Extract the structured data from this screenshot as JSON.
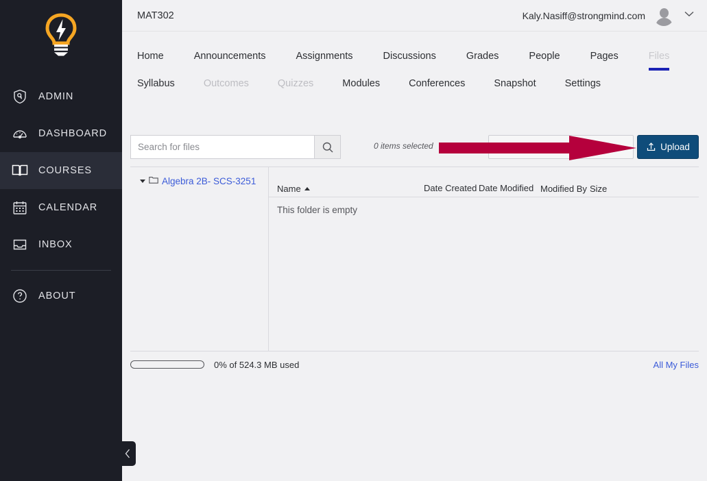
{
  "sidebar": {
    "logo": "lightbulb-logo",
    "items": [
      {
        "label": "ADMIN",
        "icon": "shield-key-icon",
        "active": false
      },
      {
        "label": "DASHBOARD",
        "icon": "speedometer-icon",
        "active": false
      },
      {
        "label": "COURSES",
        "icon": "book-icon",
        "active": true
      },
      {
        "label": "CALENDAR",
        "icon": "calendar-icon",
        "active": false
      },
      {
        "label": "INBOX",
        "icon": "inbox-icon",
        "active": false
      },
      {
        "label": "ABOUT",
        "icon": "question-circle-icon",
        "active": false
      }
    ],
    "collapse_icon": "chevron-left-icon"
  },
  "header": {
    "course_title": "MAT302",
    "user_email": "Kaly.Nasiff@strongmind.com",
    "avatar_icon": "user-avatar-icon",
    "chevron_icon": "chevron-down-icon"
  },
  "tabs": {
    "row1": [
      {
        "label": "Home",
        "state": "normal"
      },
      {
        "label": "Announcements",
        "state": "normal"
      },
      {
        "label": "Assignments",
        "state": "normal"
      },
      {
        "label": "Discussions",
        "state": "normal"
      },
      {
        "label": "Grades",
        "state": "normal"
      },
      {
        "label": "People",
        "state": "normal"
      },
      {
        "label": "Pages",
        "state": "normal"
      },
      {
        "label": "Files",
        "state": "active"
      }
    ],
    "row2": [
      {
        "label": "Syllabus",
        "state": "normal"
      },
      {
        "label": "Outcomes",
        "state": "disabled"
      },
      {
        "label": "Quizzes",
        "state": "disabled"
      },
      {
        "label": "Modules",
        "state": "normal"
      },
      {
        "label": "Conferences",
        "state": "normal"
      },
      {
        "label": "Snapshot",
        "state": "normal"
      },
      {
        "label": "Settings",
        "state": "normal"
      }
    ],
    "active_underline_color": "#1a22b5"
  },
  "toolbar": {
    "search_placeholder": "Search for files",
    "search_value": "",
    "search_icon": "magnifier-icon",
    "items_selected": "0 items selected",
    "upload_label": "Upload",
    "upload_icon": "upload-arrow-icon",
    "upload_color": "#0f4c7a",
    "annotation_arrow_color": "#b5003c"
  },
  "tree": {
    "folders": [
      {
        "label": "Algebra 2B- SCS-3251",
        "expanded": true,
        "icon": "folder-icon"
      }
    ]
  },
  "files_table": {
    "columns": [
      "Name",
      "Date Created",
      "Date Modified",
      "Modified By",
      "Size"
    ],
    "sort_column": "Name",
    "sort_direction": "ascending",
    "rows": [],
    "empty_message": "This folder is empty"
  },
  "footer": {
    "quota_percent": 0,
    "quota_text": "0% of 524.3 MB used",
    "all_files_link": "All My Files"
  }
}
